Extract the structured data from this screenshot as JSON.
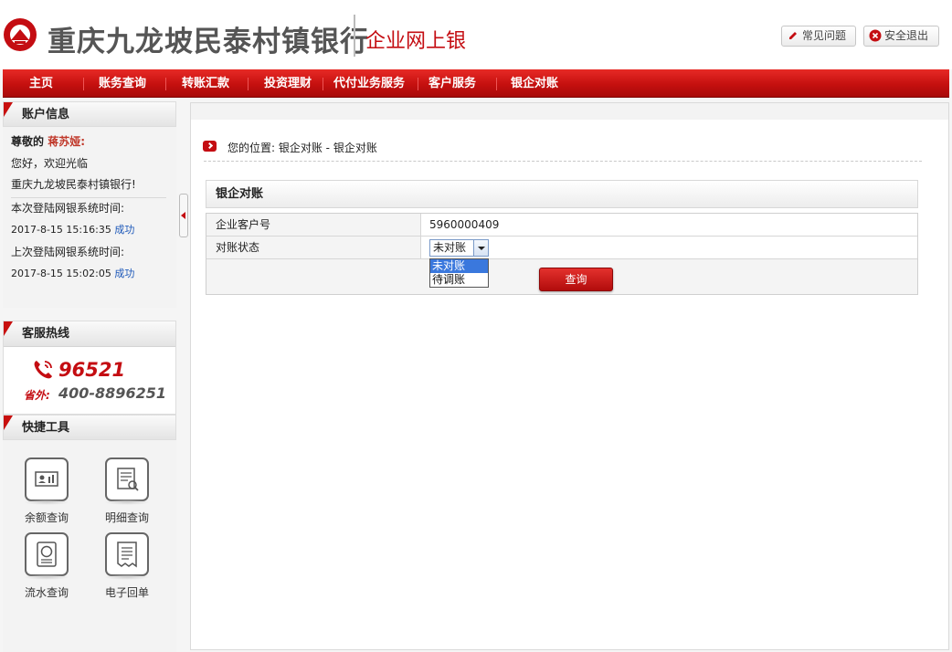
{
  "header": {
    "bank_name": "重庆九龙坡民泰村镇银行",
    "portal_name": "企业网上银",
    "faq_label": "常见问题",
    "logout_label": "安全退出"
  },
  "nav": {
    "items": [
      "主页",
      "账务查询",
      "转账汇款",
      "投资理财",
      "代付业务服务",
      "客户服务",
      "银企对账"
    ]
  },
  "sidebar": {
    "account_title": "账户信息",
    "greeting_prefix": "尊敬的",
    "customer_name": "蒋苏娅:",
    "welcome_line1": "您好，欢迎光临",
    "welcome_line2": "重庆九龙坡民泰村镇银行!",
    "this_login_label": "本次登陆网银系统时间:",
    "this_login_time": "2017-8-15 15:16:35",
    "this_login_status": "成功",
    "last_login_label": "上次登陆网银系统时间:",
    "last_login_time": "2017-8-15 15:02:05",
    "last_login_status": "成功",
    "hotline_title": "客服热线",
    "hotline_number": "96521",
    "hotline_out_label": "省外:",
    "hotline_out_number": "400-8896251",
    "tools_title": "快捷工具",
    "tools": [
      {
        "label": "余额查询",
        "icon": "balance-icon"
      },
      {
        "label": "明细查询",
        "icon": "detail-icon"
      },
      {
        "label": "流水查询",
        "icon": "statement-icon"
      },
      {
        "label": "电子回单",
        "icon": "receipt-icon"
      }
    ]
  },
  "main": {
    "breadcrumb": "您的位置:  银企对账  -  银企对账",
    "section_title": "银企对账",
    "form": {
      "customer_no_label": "企业客户号",
      "customer_no_value": "5960000409",
      "status_label": "对账状态",
      "status_selected": "未对账",
      "status_options": [
        "未对账",
        "待调账"
      ],
      "query_label": "查询"
    }
  },
  "colors": {
    "brand_red": "#c40d12",
    "link_blue": "#1a56b8",
    "select_highlight": "#3a78dd"
  }
}
